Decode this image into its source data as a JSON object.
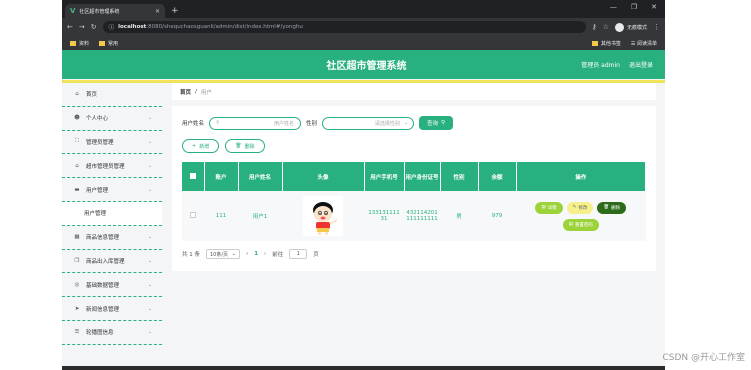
{
  "browser": {
    "tab_title": "社区超市管理系统",
    "tab_logo": "V",
    "url_host": "localhost",
    "url_rest": ":8080/shequchaosguanli/admin/dist/index.html#/yonghu",
    "profile": "无痕模式",
    "bookmarks": [
      "资料",
      "常用"
    ],
    "bookmarks_right": [
      "其他书签",
      "阅读清单"
    ]
  },
  "header": {
    "title": "社区超市管理系统",
    "admin": "管理员 admin",
    "logout": "退出登录"
  },
  "sidebar": {
    "items": [
      {
        "label": "首页",
        "icon": "home-icon",
        "glyph": "⌂",
        "chevron": false
      },
      {
        "label": "个人中心",
        "icon": "person-icon",
        "glyph": "☻",
        "chevron": true
      },
      {
        "label": "管理员管理",
        "icon": "expand-icon",
        "glyph": "⛶",
        "chevron": true
      },
      {
        "label": "超市管理员管理",
        "icon": "bank-icon",
        "glyph": "⌂",
        "chevron": true
      },
      {
        "label": "用户管理",
        "icon": "monitor-icon",
        "glyph": "▬",
        "chevron": true
      },
      {
        "label": "用户管理",
        "icon": "",
        "glyph": "",
        "chevron": false,
        "sub": true
      },
      {
        "label": "商品信息管理",
        "icon": "grid-icon",
        "glyph": "▦",
        "chevron": true
      },
      {
        "label": "商品出入库管理",
        "icon": "copy-icon",
        "glyph": "❐",
        "chevron": true
      },
      {
        "label": "基础数据管理",
        "icon": "settings-icon",
        "glyph": "◎",
        "chevron": true
      },
      {
        "label": "新闻信息管理",
        "icon": "send-icon",
        "glyph": "➤",
        "chevron": true
      },
      {
        "label": "轮播图信息",
        "icon": "sliders-icon",
        "glyph": "☰",
        "chevron": true
      }
    ]
  },
  "breadcrumb": {
    "home": "首页",
    "sep": "/",
    "current": "用户"
  },
  "filters": {
    "name_label": "用户姓名",
    "name_placeholder": "用户姓名",
    "gender_label": "性别",
    "gender_placeholder": "请选择性别",
    "search": "查询"
  },
  "actions": {
    "add": "新增",
    "delete": "删除"
  },
  "table": {
    "headers": [
      "账户",
      "用户姓名",
      "头像",
      "用户手机号",
      "用户身份证号",
      "性别",
      "余额",
      "操作"
    ],
    "rows": [
      {
        "account": "111",
        "name": "用户1",
        "phone": "13313111131",
        "idcard": "432114201111111111",
        "gender": "男",
        "balance": "979"
      }
    ],
    "buttons": {
      "detail": "详情",
      "edit": "修改",
      "delete": "删除",
      "reset": "重置密码"
    }
  },
  "pager": {
    "total": "共 1 条",
    "page_size": "10条/页",
    "current": "1",
    "goto_label": "前往",
    "goto_value": "1",
    "page_unit": "页"
  },
  "watermark": "CSDN @开心工作室",
  "colors": {
    "primary": "#29b07f",
    "accent": "#f0e35a"
  }
}
